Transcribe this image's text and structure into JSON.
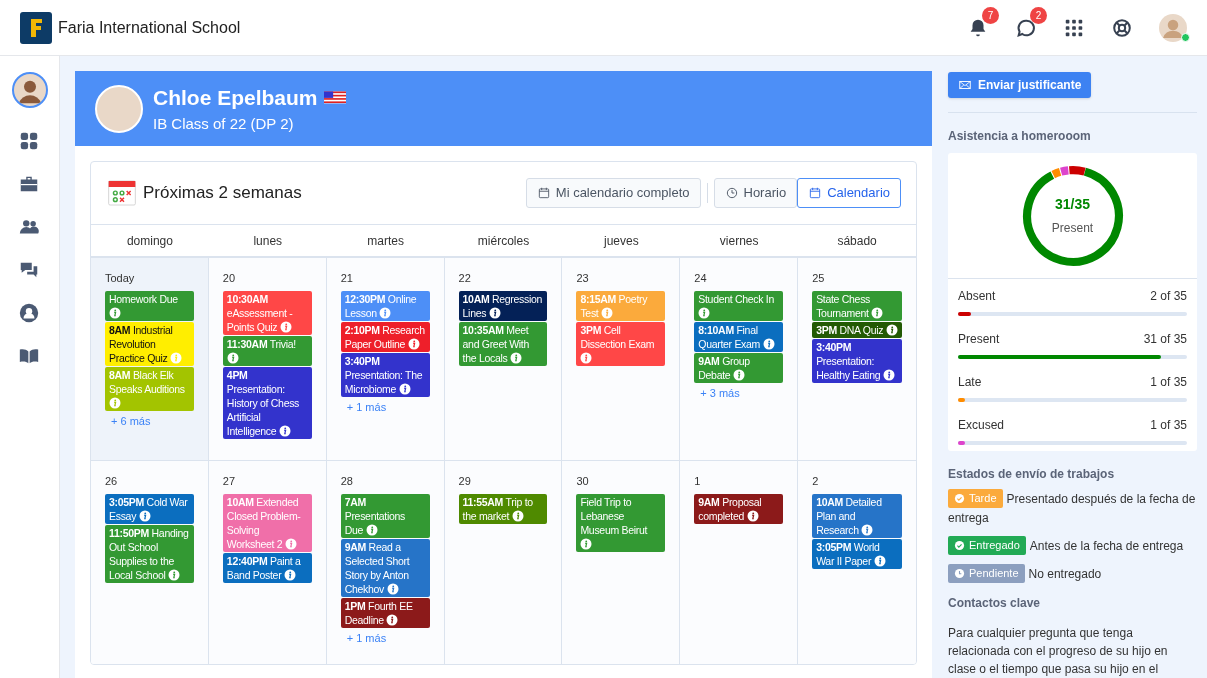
{
  "topbar": {
    "school": "Faria International School",
    "notifications": "7",
    "messages": "2"
  },
  "student": {
    "name": "Chloe Epelbaum",
    "class": "IB Class of 22 (DP 2)"
  },
  "calendar": {
    "title": "Próximas 2 semanas",
    "buttons": [
      {
        "label": "Mi calendario completo",
        "selected": false
      }
    ],
    "views": [
      {
        "label": "Horario",
        "selected": false
      },
      {
        "label": "Calendario",
        "selected": true
      }
    ],
    "weekdays": [
      "domingo",
      "lunes",
      "martes",
      "miércoles",
      "jueves",
      "viernes",
      "sábado"
    ],
    "weeks": [
      [
        {
          "date": "Today",
          "today": true,
          "more": "+ 6 más",
          "events": [
            {
              "title": "Homework Due",
              "color": "#339933"
            },
            {
              "time": "8AM",
              "title": "Industrial Revolution Practice Quiz",
              "color": "#ffee00"
            },
            {
              "time": "8AM",
              "title": "Black Elk Speaks Auditions",
              "color": "#a3c400"
            }
          ]
        },
        {
          "date": "20",
          "today": false,
          "events": [
            {
              "time": "10:30AM",
              "title": "eAssessment - Points Quiz",
              "color": "#ff4747"
            },
            {
              "time": "11:30AM",
              "title": "Trivia!",
              "color": "#339933"
            },
            {
              "time": "4PM",
              "title": "Presentation: History of Chess Artificial Intelligence",
              "color": "#3333cc"
            }
          ]
        },
        {
          "date": "21",
          "today": false,
          "more": "+ 1 más",
          "events": [
            {
              "time": "12:30PM",
              "title": "Online Lesson",
              "color": "#4d8ff7"
            },
            {
              "time": "2:10PM",
              "title": "Research Paper Outline",
              "color": "#ee1f2a"
            },
            {
              "time": "3:40PM",
              "title": "Presentation: The Microbiome",
              "color": "#3333cc"
            }
          ]
        },
        {
          "date": "22",
          "today": false,
          "events": [
            {
              "time": "10AM",
              "title": "Regression Lines",
              "color": "#042157"
            },
            {
              "time": "10:35AM",
              "title": "Meet and Greet With the Locals",
              "color": "#339933"
            }
          ]
        },
        {
          "date": "23",
          "today": false,
          "events": [
            {
              "time": "8:15AM",
              "title": "Poetry Test",
              "color": "#fbaa3c"
            },
            {
              "time": "3PM",
              "title": "Cell Dissection Exam",
              "color": "#ff4747"
            }
          ]
        },
        {
          "date": "24",
          "today": false,
          "more": "+ 3 más",
          "events": [
            {
              "title": "Student Check In",
              "color": "#339933"
            },
            {
              "time": "8:10AM",
              "title": "Final Quarter Exam",
              "color": "#0b6ebf"
            },
            {
              "time": "9AM",
              "title": "Group Debate",
              "color": "#339933"
            }
          ]
        },
        {
          "date": "25",
          "today": false,
          "events": [
            {
              "title": "State Chess Tournament",
              "color": "#339933"
            },
            {
              "time": "3PM",
              "title": "DNA Quiz",
              "color": "#235a04"
            },
            {
              "time": "3:40PM",
              "title": "Presentation: Healthy Eating",
              "color": "#3333cc"
            }
          ]
        }
      ],
      [
        {
          "date": "26",
          "today": false,
          "events": [
            {
              "time": "3:05PM",
              "title": "Cold War Essay",
              "color": "#0b6ebf"
            },
            {
              "time": "11:50PM",
              "title": "Handing Out School Supplies to the Local School",
              "color": "#339933"
            }
          ]
        },
        {
          "date": "27",
          "today": false,
          "events": [
            {
              "time": "10AM",
              "title": "Extended Closed Problem-Solving Worksheet 2",
              "color": "#f06fa9"
            },
            {
              "time": "12:40PM",
              "title": "Paint a Band Poster",
              "color": "#0b6ebf"
            }
          ]
        },
        {
          "date": "28",
          "today": false,
          "more": "+ 1 más",
          "events": [
            {
              "time": "7AM",
              "title": "Presentations Due",
              "color": "#339933"
            },
            {
              "time": "9AM",
              "title": "Read a Selected Short Story by Anton Chekhov",
              "color": "#2674c8"
            },
            {
              "time": "1PM",
              "title": "Fourth EE Deadline",
              "color": "#8c1a1a"
            }
          ]
        },
        {
          "date": "29",
          "today": false,
          "events": [
            {
              "time": "11:55AM",
              "title": "Trip to the market",
              "color": "#4f8a00"
            }
          ]
        },
        {
          "date": "30",
          "today": false,
          "events": [
            {
              "title": "Field Trip to Lebanese Museum Beirut",
              "color": "#339933"
            }
          ]
        },
        {
          "date": "1",
          "today": false,
          "events": [
            {
              "time": "9AM",
              "title": "Proposal completed",
              "color": "#8c1a1a"
            }
          ]
        },
        {
          "date": "2",
          "today": false,
          "events": [
            {
              "time": "10AM",
              "title": "Detailed Plan and Research",
              "color": "#2674c8"
            },
            {
              "time": "3:05PM",
              "title": "World War II Paper",
              "color": "#0b6ebf"
            }
          ]
        }
      ]
    ]
  },
  "sidebar_right": {
    "button": "Enviar justificante",
    "attendance_title": "Asistencia a homerooom",
    "summary": "31/35",
    "summary_label": "Present",
    "attendance": [
      {
        "label": "Absent",
        "value": "2 of 35",
        "level": 0.057,
        "color": "#cc0000"
      },
      {
        "label": "Present",
        "value": "31 of 35",
        "level": 0.886,
        "color": "#008800"
      },
      {
        "label": "Late",
        "value": "1 of 35",
        "level": 0.029,
        "color": "#ff8c00"
      },
      {
        "label": "Excused",
        "value": "1 of 35",
        "level": 0.029,
        "color": "#dd44cc"
      }
    ],
    "status_title": "Estados de envío de trabajos",
    "statuses": [
      {
        "badge": "Tarde",
        "kind": "check",
        "color": "#fbaa3c",
        "text": "Presentado después de la fecha de entrega"
      },
      {
        "badge": "Entregado",
        "kind": "check",
        "color": "#22aa55",
        "text": "Antes de la fecha de entrega"
      },
      {
        "badge": "Pendiente",
        "kind": "clock",
        "color": "#8c9fbf",
        "text": "No entregado"
      }
    ],
    "contacts_title": "Contactos clave",
    "contacts_text": "Para cualquier pregunta que tenga relacionada con el progreso de su hijo en clase o el tiempo que pasa su hijo en el"
  }
}
